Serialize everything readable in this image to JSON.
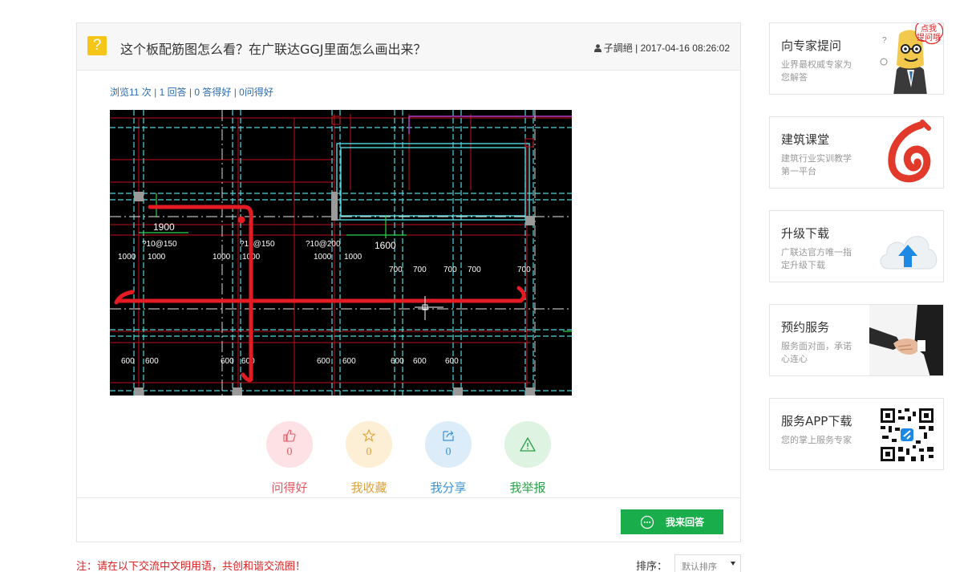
{
  "question": {
    "title": "这个板配筋图怎么看？在广联达GGJ里面怎么画出来？",
    "author": "子調絕",
    "date": "2017-04-16 08:26:02",
    "meta_separator": "|",
    "stats": "浏览11 次 | 1 回答 | 0 答得好 | 0问得好"
  },
  "cad": {
    "labels_1900": "1900",
    "labels_1600": "1600",
    "bars": [
      "?10@150",
      "?10@150",
      "?10@200"
    ],
    "dims": [
      "1000",
      "1000",
      "1000",
      "1000",
      "1000",
      "1000",
      "700",
      "700",
      "700",
      "700",
      "700",
      "600",
      "600",
      "600",
      "600",
      "600",
      "600",
      "600",
      "600",
      "600"
    ]
  },
  "actions": [
    {
      "label": "问得好",
      "count": "0",
      "icon": "thumbs-up-icon"
    },
    {
      "label": "我收藏",
      "count": "0",
      "icon": "star-icon"
    },
    {
      "label": "我分享",
      "count": "0",
      "icon": "share-icon"
    },
    {
      "label": "我举报",
      "icon": "warning-icon"
    }
  ],
  "answer_button": "我来回答",
  "notice": "注：请在以下交流中文明用语，共创和谐交流圈！",
  "sort": {
    "label": "排序：",
    "value": "默认排序"
  },
  "sidebar": [
    {
      "title": "向专家提问",
      "desc": "业界最权威专家为您解答",
      "bubble": "点我提问哦",
      "icon": "expert-mascot-icon"
    },
    {
      "title": "建筑课堂",
      "desc": "建筑行业实训教学第一平台",
      "icon": "academy-logo-icon"
    },
    {
      "title": "升级下载",
      "desc": "广联达官方唯一指定升级下载",
      "icon": "cloud-upload-icon"
    },
    {
      "title": "预约服务",
      "desc": "服务面对面，承诺心连心",
      "icon": "handshake-icon"
    },
    {
      "title": "服务APP下载",
      "desc": "您的掌上服务专家",
      "icon": "qr-code-icon"
    }
  ],
  "colors": {
    "accent_green": "#1aad4b",
    "link_blue": "#2b6cb5",
    "notice_red": "#e02020",
    "question_yellow": "#f5c518"
  }
}
